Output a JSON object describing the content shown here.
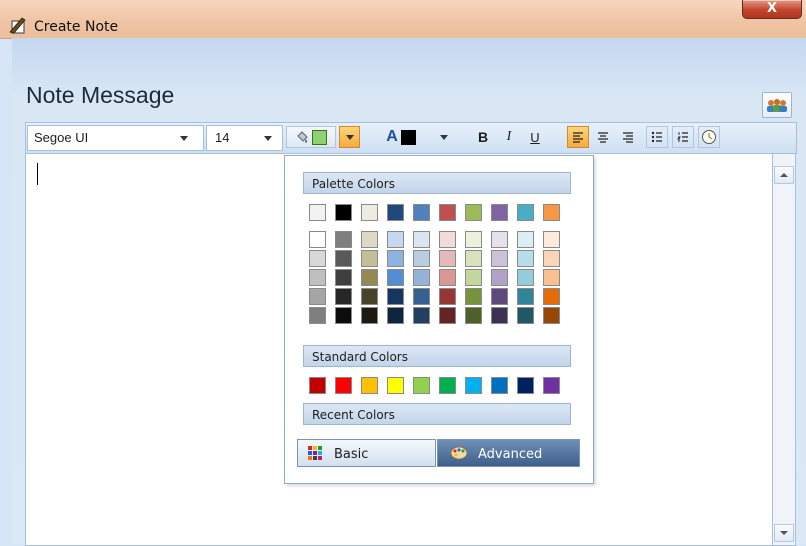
{
  "window": {
    "title": "Create Note",
    "close_label": "X"
  },
  "header": {
    "title": "Note Message"
  },
  "toolbar": {
    "font_name": "Segoe UI",
    "font_size": "14",
    "highlight_color": "#8fd16e",
    "font_color": "#000000",
    "bold_label": "B",
    "italic_label": "I",
    "underline_label": "U",
    "align_active": "left"
  },
  "editor": {
    "content": ""
  },
  "color_picker": {
    "palette_title": "Palette Colors",
    "standard_title": "Standard Colors",
    "recent_title": "Recent Colors",
    "palette_top": [
      "#f2f2f2",
      "#000000",
      "#eeece1",
      "#1f497d",
      "#4f81bd",
      "#c0504d",
      "#9bbb59",
      "#8064a2",
      "#4bacc6",
      "#f79646"
    ],
    "palette_shades": [
      [
        "#ffffff",
        "#7f7f7f",
        "#ddd9c3",
        "#c6d9f0",
        "#dbe5f1",
        "#f2dcdb",
        "#ebf1dd",
        "#e5e0ec",
        "#dbeef3",
        "#fdeada"
      ],
      [
        "#d8d8d8",
        "#595959",
        "#c4bd97",
        "#8db3e2",
        "#b8cce4",
        "#e5b9b7",
        "#d7e3bc",
        "#ccc1d9",
        "#b7dde8",
        "#fbd5b5"
      ],
      [
        "#bfbfbf",
        "#3f3f3f",
        "#938953",
        "#548dd4",
        "#95b3d7",
        "#d99694",
        "#c3d69b",
        "#b2a2c7",
        "#92cddc",
        "#fac08f"
      ],
      [
        "#a5a5a5",
        "#262626",
        "#494429",
        "#17365d",
        "#366092",
        "#953734",
        "#76923c",
        "#5f497a",
        "#31859b",
        "#e36c09"
      ],
      [
        "#7f7f7f",
        "#0c0c0c",
        "#1d1b10",
        "#0f243e",
        "#244061",
        "#632423",
        "#4f6128",
        "#3f3151",
        "#205867",
        "#974806"
      ]
    ],
    "standard_colors": [
      "#c00000",
      "#ff0000",
      "#ffc000",
      "#ffff00",
      "#92d050",
      "#00b050",
      "#00b0f0",
      "#0070c0",
      "#002060",
      "#7030a0"
    ],
    "tab_basic": "Basic",
    "tab_advanced": "Advanced"
  }
}
